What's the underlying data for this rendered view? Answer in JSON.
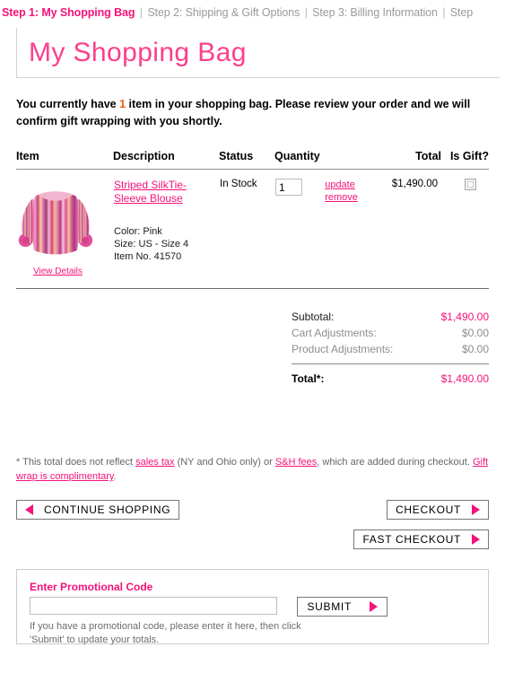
{
  "breadcrumb": {
    "steps": [
      {
        "label": "Step 1: My Shopping Bag",
        "active": true
      },
      {
        "label": "Step 2: Shipping & Gift Options",
        "active": false
      },
      {
        "label": "Step 3: Billing Information",
        "active": false
      },
      {
        "label": "Step",
        "active": false
      }
    ],
    "separator": "|"
  },
  "header": {
    "title": "My Shopping Bag"
  },
  "intro": {
    "before": "You currently have ",
    "count": "1",
    "after": " item in your shopping bag.  Please review your order and we will confirm gift wrapping with you shortly."
  },
  "table": {
    "headers": {
      "item": "Item",
      "description": "Description",
      "status": "Status",
      "quantity": "Quantity",
      "total": "Total",
      "is_gift": "Is Gift?"
    },
    "row": {
      "view_details": "View Details",
      "product_name": "Striped SilkTie-Sleeve Blouse",
      "color": "Color: Pink",
      "size": "Size: US - Size 4",
      "item_no": "Item No. 41570",
      "status": "In Stock",
      "quantity_value": "1",
      "update_label": "update",
      "remove_label": "remove",
      "total": "$1,490.00"
    }
  },
  "totals": {
    "subtotal_label": "Subtotal:",
    "subtotal_value": "$1,490.00",
    "cart_adj_label": "Cart Adjustments:",
    "cart_adj_value": "$0.00",
    "product_adj_label": "Product Adjustments:",
    "product_adj_value": "$0.00",
    "total_label": "Total*:",
    "total_value": "$1,490.00"
  },
  "footnote": {
    "p1": "* This total does not reflect ",
    "link1": "sales tax",
    "p2": " (NY and Ohio only) or ",
    "link2": "S&H fees",
    "p3": ", which are added during checkout. ",
    "link3": "Gift wrap is complimentary",
    "p4": "."
  },
  "buttons": {
    "continue_shopping": "CONTINUE SHOPPING",
    "checkout": "CHECKOUT",
    "fast_checkout": "FAST CHECKOUT"
  },
  "promo": {
    "label": "Enter Promotional Code",
    "value": "",
    "placeholder": "",
    "submit": "SUBMIT",
    "help_line1": "If you have a promotional code, please enter it here, then click",
    "help_line2": "'Submit' to update your totals."
  },
  "colors": {
    "accent_pink": "#f5127a",
    "title_pink": "#fc3f8c",
    "count_orange": "#ef5a12",
    "muted_gray": "#8d8d8d"
  }
}
